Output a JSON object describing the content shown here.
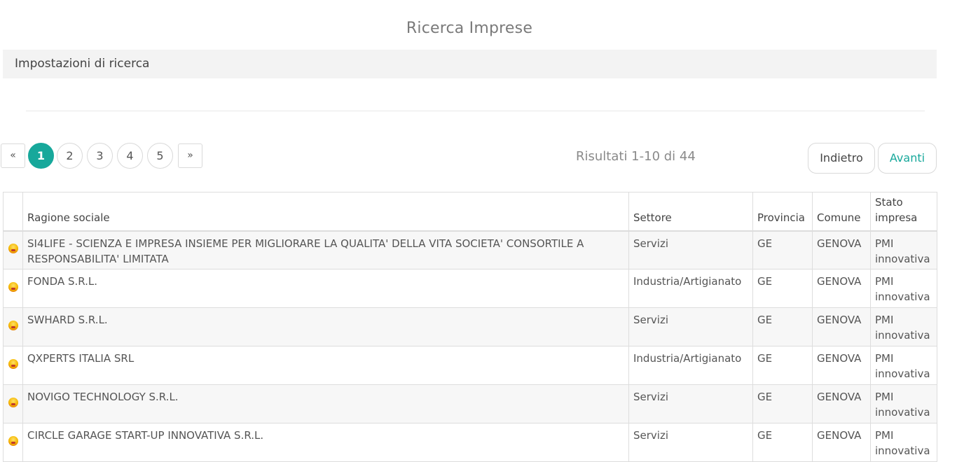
{
  "page": {
    "title": "Ricerca Imprese"
  },
  "settings": {
    "label": "Impostazioni di ricerca"
  },
  "pagination": {
    "prev_label": "«",
    "next_label": "»",
    "pages": [
      "1",
      "2",
      "3",
      "4",
      "5"
    ],
    "active_page": "1",
    "results_text": "Risultati 1-10 di 44"
  },
  "nav": {
    "back_label": "Indietro",
    "next_label": "Avanti"
  },
  "colors": {
    "accent": "#17a89b",
    "status_icon": "#f5b800"
  },
  "table": {
    "headers": {
      "icon": "",
      "name": "Ragione sociale",
      "sector": "Settore",
      "province": "Provincia",
      "city": "Comune",
      "status": "Stato impresa"
    },
    "rows": [
      {
        "icon": "status-warning-icon",
        "name": "SI4LIFE - SCIENZA E IMPRESA INSIEME PER MIGLIORARE LA QUALITA' DELLA VITA SOCIETA' CONSORTILE A RESPONSABILITA' LIMITATA",
        "sector": "Servizi",
        "province": "GE",
        "city": "GENOVA",
        "status": "PMI innovativa"
      },
      {
        "icon": "status-warning-icon",
        "name": "FONDA S.R.L.",
        "sector": "Industria/Artigianato",
        "province": "GE",
        "city": "GENOVA",
        "status": "PMI innovativa"
      },
      {
        "icon": "status-warning-icon",
        "name": "SWHARD S.R.L.",
        "sector": "Servizi",
        "province": "GE",
        "city": "GENOVA",
        "status": "PMI innovativa"
      },
      {
        "icon": "status-warning-icon",
        "name": "QXPERTS ITALIA SRL",
        "sector": "Industria/Artigianato",
        "province": "GE",
        "city": "GENOVA",
        "status": "PMI innovativa"
      },
      {
        "icon": "status-warning-icon",
        "name": "NOVIGO TECHNOLOGY S.R.L.",
        "sector": "Servizi",
        "province": "GE",
        "city": "GENOVA",
        "status": "PMI innovativa"
      },
      {
        "icon": "status-warning-icon",
        "name": "CIRCLE GARAGE START-UP INNOVATIVA S.R.L.",
        "sector": "Servizi",
        "province": "GE",
        "city": "GENOVA",
        "status": "PMI innovativa"
      }
    ]
  }
}
